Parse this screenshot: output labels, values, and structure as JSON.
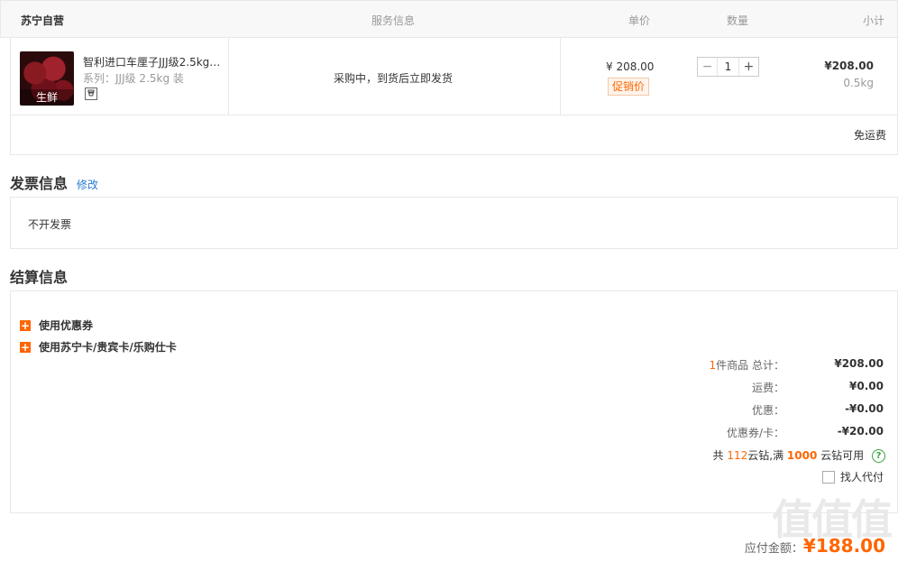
{
  "cart": {
    "header": {
      "store": "苏宁自营",
      "service": "服务信息",
      "price": "单价",
      "quantity": "数量",
      "subtotal": "小计"
    },
    "item": {
      "thumb_label": "生鲜",
      "title": "智利进口车厘子JJJ级2.5kg…",
      "spec": "系列：JJJ级 2.5kg 装",
      "tag_icon": "sale-tag-icon",
      "service_text": "采购中，到货后立即发货",
      "price": "¥ 208.00",
      "promo_label": "促销价",
      "qty_minus": "−",
      "qty_value": "1",
      "qty_plus": "+",
      "subtotal": "¥208.00",
      "weight": "0.5kg"
    },
    "freight_note": "免运费"
  },
  "invoice": {
    "title": "发票信息",
    "edit": "修改",
    "value": "不开发票"
  },
  "settlement": {
    "title": "结算信息",
    "coupon_toggle": "使用优惠券",
    "card_toggle": "使用苏宁卡/贵宾卡/乐购仕卡",
    "items_count": "1",
    "items_label": "件商品 总计：",
    "total": "¥208.00",
    "freight_label": "运费：",
    "freight": "¥0.00",
    "discount_label": "优惠：",
    "discount": "-¥0.00",
    "coupon_label": "优惠券/卡：",
    "coupon": "-¥20.00",
    "diamond_prefix": "共",
    "diamond_count": "112",
    "diamond_mid": "云钻,满",
    "diamond_threshold": "1000",
    "diamond_suffix": "云钻可用",
    "help_icon": "?",
    "proxy_pay": "找人代付"
  },
  "payable": {
    "label": "应付金额：",
    "amount": "¥188.00"
  },
  "watermark": "值什么值得买",
  "colors": {
    "accent": "#ff6600",
    "link": "#2a7bd1",
    "help": "#3aa33a"
  }
}
